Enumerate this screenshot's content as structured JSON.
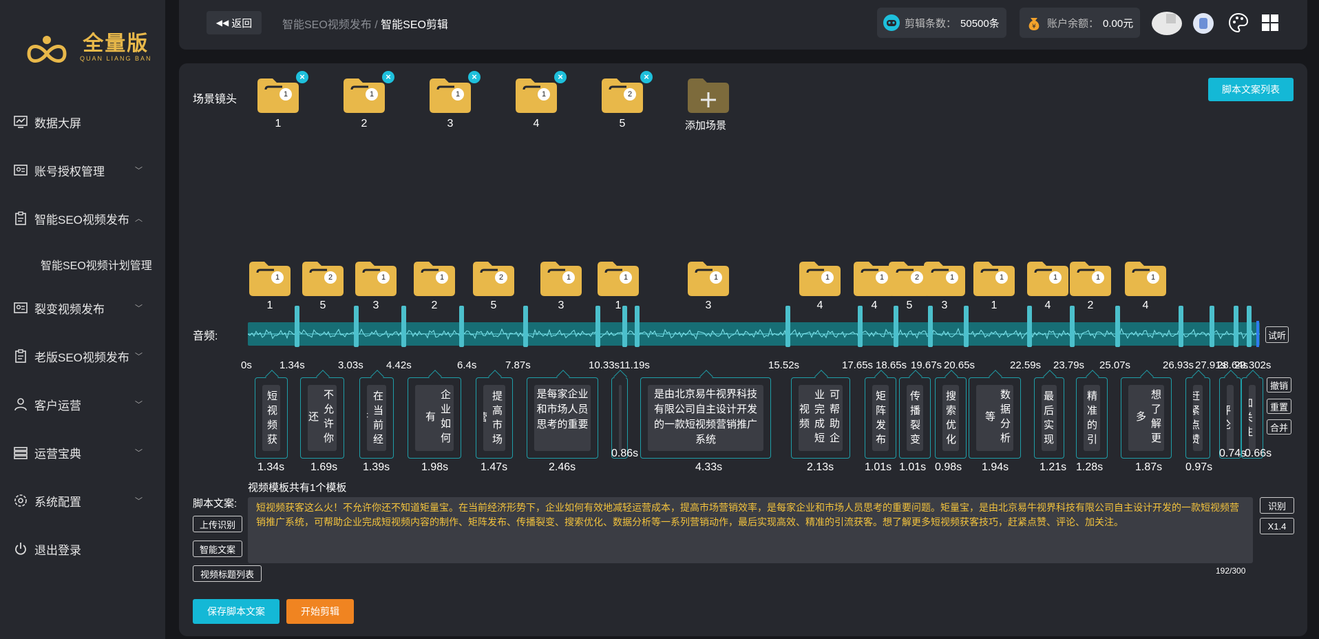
{
  "sidebar": {
    "logo_text": "全量版",
    "logo_sub": "QUAN LIANG BAN",
    "items": [
      {
        "label": "数据大屏",
        "icon": "monitor-chart-icon",
        "has_chevron": false
      },
      {
        "label": "账号授权管理",
        "icon": "id-card-icon",
        "has_chevron": true
      },
      {
        "label": "智能SEO视频发布",
        "icon": "clipboard-icon",
        "has_chevron": true,
        "expanded": true
      },
      {
        "label": "裂变视频发布",
        "icon": "id-card-icon",
        "has_chevron": true
      },
      {
        "label": "老版SEO视频发布",
        "icon": "clipboard-icon",
        "has_chevron": true
      },
      {
        "label": "客户运营",
        "icon": "user-icon",
        "has_chevron": true
      },
      {
        "label": "运营宝典",
        "icon": "layers-icon",
        "has_chevron": true
      },
      {
        "label": "系统配置",
        "icon": "gear-icon",
        "has_chevron": true
      },
      {
        "label": "退出登录",
        "icon": "power-icon",
        "has_chevron": false
      }
    ],
    "submenu_label": "智能SEO视频计划管理"
  },
  "header": {
    "back_label": "返回",
    "breadcrumb_parent": "智能SEO视频发布",
    "breadcrumb_sep": " / ",
    "breadcrumb_current": "智能SEO剪辑",
    "clips_label": "剪辑条数：",
    "clips_value": "50500条",
    "balance_label": "账户余额：",
    "balance_value": "0.00元"
  },
  "scenes": {
    "label": "场景镜头",
    "script_list_button": "脚本文案列表",
    "folders": [
      {
        "name": "1",
        "badge": "1"
      },
      {
        "name": "2",
        "badge": "1"
      },
      {
        "name": "3",
        "badge": "1"
      },
      {
        "name": "4",
        "badge": "1"
      },
      {
        "name": "5",
        "badge": "2"
      }
    ],
    "add_label": "添加场景"
  },
  "timeline": {
    "folders": [
      {
        "name": "1",
        "badge": "1"
      },
      {
        "name": "5",
        "badge": "2"
      },
      {
        "name": "3",
        "badge": "1"
      },
      {
        "name": "2",
        "badge": "1"
      },
      {
        "name": "5",
        "badge": "2"
      },
      {
        "name": "3",
        "badge": "1"
      },
      {
        "name": "1",
        "badge": "1"
      },
      {
        "name": "3",
        "badge": "1"
      },
      {
        "name": "4",
        "badge": "1"
      },
      {
        "name": "4",
        "badge": "1"
      },
      {
        "name": "5",
        "badge": "2"
      },
      {
        "name": "3",
        "badge": "1"
      },
      {
        "name": "1",
        "badge": "1"
      },
      {
        "name": "4",
        "badge": "1"
      },
      {
        "name": "2",
        "badge": "1"
      },
      {
        "name": "4",
        "badge": "1"
      }
    ],
    "audio_label": "音频:",
    "listen_button": "试听",
    "ticks": [
      "0s",
      "1.34s",
      "3.03s",
      "4.42s",
      "6.4s",
      "7.87s",
      "10.33s",
      "11.19s",
      "15.52s",
      "17.65s",
      "18.65s",
      "19.67s",
      "20.65s",
      "22.59s",
      "23.79s",
      "25.07s",
      "26.93s",
      "27.91s",
      "28.64s",
      "29.302s"
    ],
    "cards": [
      {
        "text": "短视频获客",
        "dur": "1.34s"
      },
      {
        "text": "不允许你还",
        "dur": "1.69s"
      },
      {
        "text": "在当前经济",
        "dur": "1.39s"
      },
      {
        "text": "企业如何有",
        "dur": "1.98s"
      },
      {
        "text": "提高市场营",
        "dur": "1.47s"
      },
      {
        "text": "是每家企业和市场人员思考的重要",
        "dur": "2.46s"
      },
      {
        "text": "矩量宝",
        "dur": "0.86s"
      },
      {
        "text": "是由北京易牛视界科技有限公司自主设计开发的一款短视频营销推广系统",
        "dur": "4.33s"
      },
      {
        "text": "可帮助企业完成短视频",
        "dur": "2.13s"
      },
      {
        "text": "矩阵发布",
        "dur": "1.01s"
      },
      {
        "text": "传播裂变",
        "dur": "1.01s"
      },
      {
        "text": "搜索优化",
        "dur": "0.98s"
      },
      {
        "text": "数据分析等",
        "dur": "1.94s"
      },
      {
        "text": "最后实现高",
        "dur": "1.21s"
      },
      {
        "text": "精准的引流",
        "dur": "1.28s"
      },
      {
        "text": "想了解更多",
        "dur": "1.87s"
      },
      {
        "text": "赶紧点赞",
        "dur": "0.97s"
      },
      {
        "text": "评论",
        "dur": "0.74s"
      },
      {
        "text": "加关注",
        "dur": "0.66s"
      }
    ],
    "undo_button": "撤销",
    "reset_button": "重置",
    "merge_button": "合并"
  },
  "script": {
    "template_note": "视频模板共有1个模板",
    "label": "脚本文案:",
    "upload_button": "上传识别",
    "smart_button": "智能文案",
    "titles_button": "视频标题列表",
    "text": "短视频获客这么火！不允许你还不知道矩量宝。在当前经济形势下，企业如何有效地减轻运营成本，提高市场营销效率，是每家企业和市场人员思考的重要问题。矩量宝，是由北京易牛视界科技有限公司自主设计开发的一款短视频营销推广系统，可帮助企业完成短视频内容的制作、矩阵发布、传播裂变、搜索优化、数据分析等一系列营销动作，最后实现高效、精准的引流获客。想了解更多短视频获客技巧，赶紧点赞、评论、加关注。",
    "counter": "192/300",
    "recognize_button": "识别",
    "speed_button": "X1.4",
    "save_button": "保存脚本文案",
    "start_button": "开始剪辑"
  },
  "colors": {
    "accent": "#14b8d6",
    "orange": "#f08421",
    "folder": "#e8b84a",
    "wave": "#176e75"
  }
}
